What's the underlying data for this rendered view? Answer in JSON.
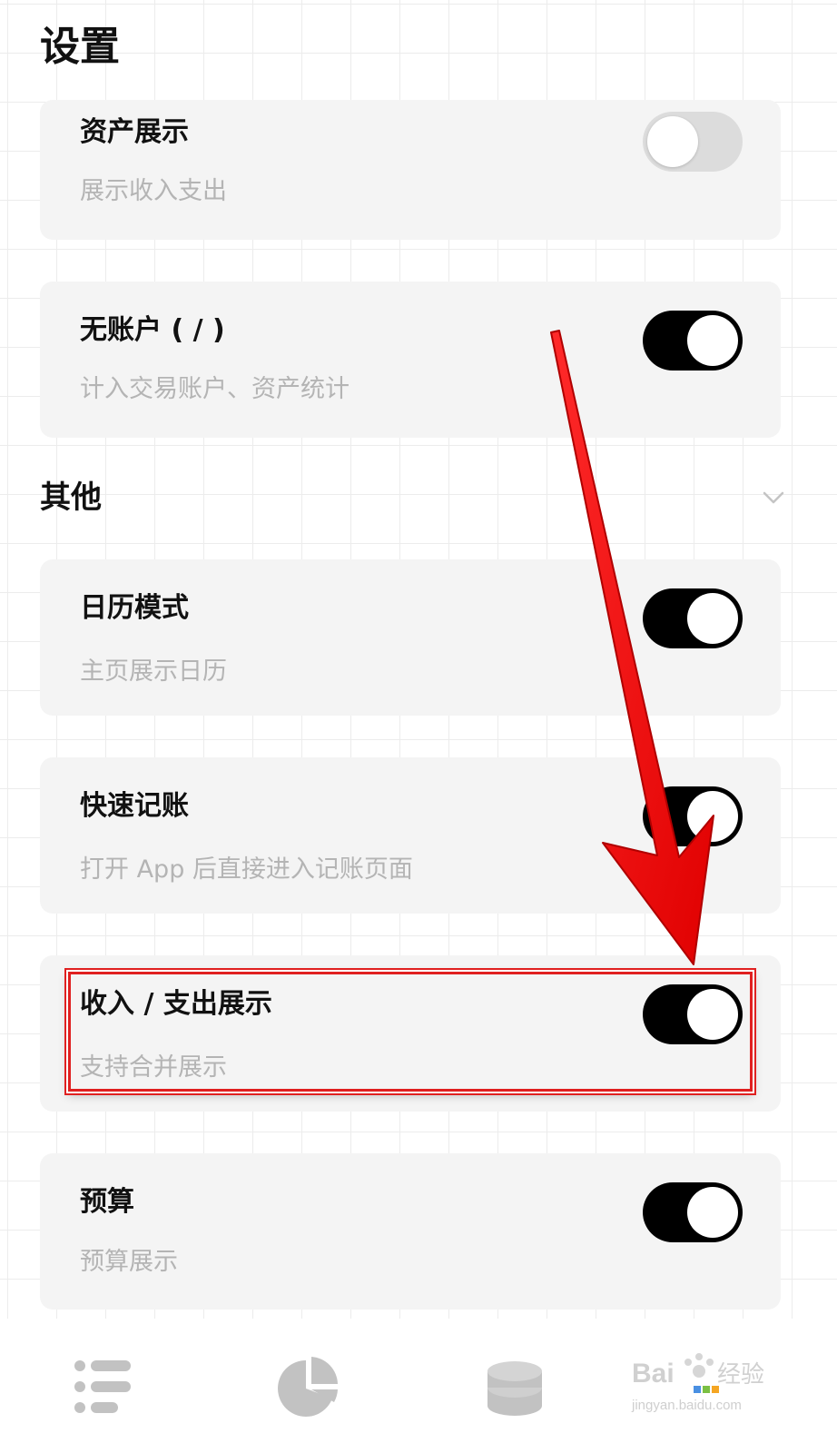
{
  "page": {
    "title": "设置"
  },
  "cards_top": [
    {
      "title": "资产展示",
      "subtitle": "展示收入支出",
      "toggle_on": false
    },
    {
      "title": "无账户 ( / )",
      "subtitle": "计入交易账户、资产统计",
      "toggle_on": true
    }
  ],
  "section_other": {
    "title": "其他",
    "chevron_icon": "chevron-down-icon"
  },
  "cards_other": [
    {
      "title": "日历模式",
      "subtitle": "主页展示日历",
      "toggle_on": true
    },
    {
      "title": "快速记账",
      "subtitle": "打开 App 后直接进入记账页面",
      "toggle_on": true
    },
    {
      "title": "收入 / 支出展示",
      "subtitle": "支持合并展示",
      "toggle_on": true,
      "highlighted": true
    },
    {
      "title": "预算",
      "subtitle": "预算展示",
      "toggle_on": true
    }
  ],
  "tabbar": {
    "tabs": [
      {
        "icon": "list-icon"
      },
      {
        "icon": "pie-chart-icon"
      },
      {
        "icon": "coin-stack-icon"
      },
      {
        "icon": "settings-tab"
      }
    ]
  },
  "watermark": {
    "text_brand": "Bai",
    "text_cn": "经验",
    "text_url": "jingyan.baidu.com"
  },
  "colors": {
    "card_bg": "#f4f4f4",
    "toggle_on": "#000000",
    "toggle_off": "#dcdcdc",
    "subtitle": "#b4b4b4",
    "annotation_red": "#e02020"
  }
}
